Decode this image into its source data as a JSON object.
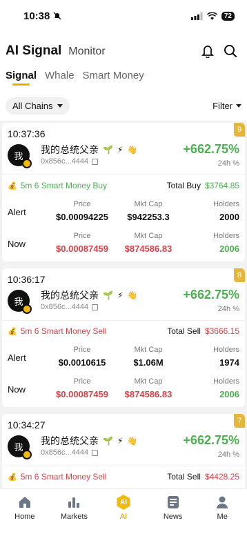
{
  "status": {
    "time": "10:38",
    "battery": "72"
  },
  "header": {
    "title": "AI Signal",
    "monitor": "Monitor"
  },
  "tabs": [
    {
      "label": "Signal"
    },
    {
      "label": "Whale"
    },
    {
      "label": "Smart Money"
    }
  ],
  "filters": {
    "chain": "All Chains",
    "filter": "Filter"
  },
  "labels": {
    "price": "Price",
    "mkt_cap": "Mkt Cap",
    "holders": "Holders",
    "alert": "Alert",
    "now": "Now",
    "change_label": "24h %"
  },
  "cards": [
    {
      "time": "10:37:36",
      "rank": "9",
      "avatar": "我",
      "name": "我的总统父亲",
      "address": "0x856c...4444",
      "change": "+662.75%",
      "summary": "5m 6 Smart Money Buy",
      "summary_type": "buy",
      "total_label": "Total Buy",
      "total": "$3764.85",
      "alert": {
        "price": "$0.00094225",
        "mkt_cap": "$942253.3",
        "holders": "2000"
      },
      "now": {
        "price": "$0.00087459",
        "mkt_cap": "$874586.83",
        "holders": "2006"
      }
    },
    {
      "time": "10:36:17",
      "rank": "8",
      "avatar": "我",
      "name": "我的总统父亲",
      "address": "0x856c...4444",
      "change": "+662.75%",
      "summary": "5m 6 Smart Money Sell",
      "summary_type": "sell",
      "total_label": "Total Sell",
      "total": "$3666.15",
      "alert": {
        "price": "$0.0010615",
        "mkt_cap": "$1.06M",
        "holders": "1974"
      },
      "now": {
        "price": "$0.00087459",
        "mkt_cap": "$874586.83",
        "holders": "2006"
      }
    },
    {
      "time": "10:34:27",
      "rank": "7",
      "avatar": "我",
      "name": "我的总统父亲",
      "address": "0x856c...4444",
      "change": "+662.75%",
      "summary": "5m 6 Smart Money Sell",
      "summary_type": "sell",
      "total_label": "Total Sell",
      "total": "$4428.25"
    }
  ],
  "tabbar": [
    {
      "label": "Home",
      "icon": "home-icon"
    },
    {
      "label": "Markets",
      "icon": "markets-icon"
    },
    {
      "label": "AI",
      "icon": "ai-icon"
    },
    {
      "label": "News",
      "icon": "news-icon"
    },
    {
      "label": "Me",
      "icon": "person-icon"
    }
  ]
}
